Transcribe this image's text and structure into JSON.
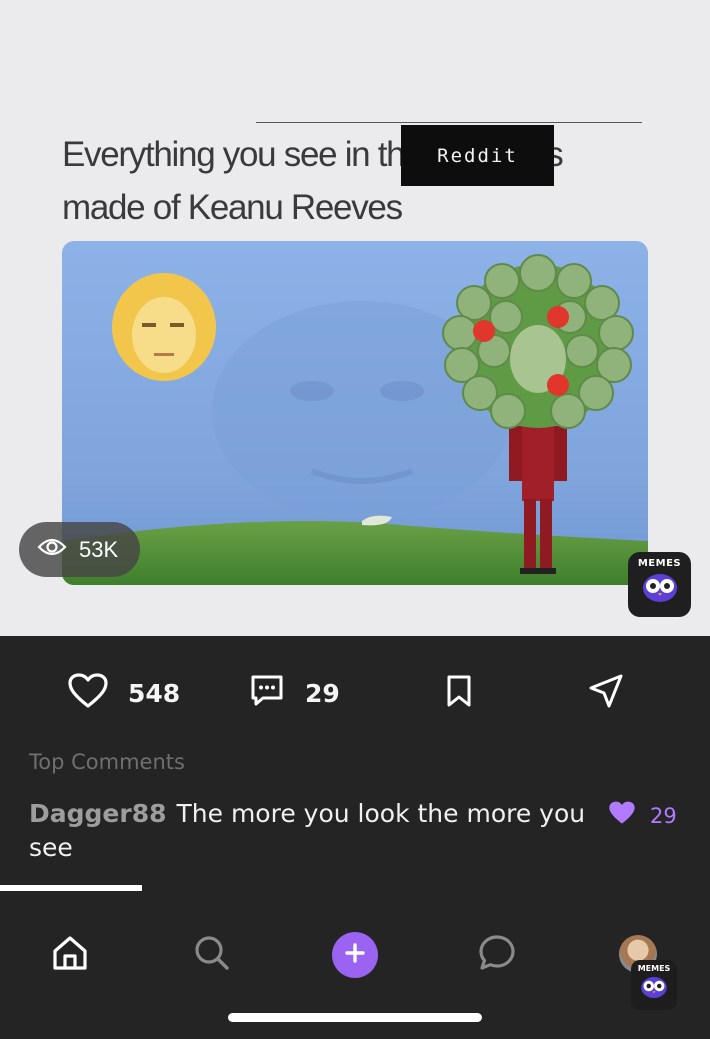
{
  "post": {
    "caption": "Everything you see in this picture is made of Keanu Reeves",
    "watermark": "Reddit",
    "views": "53K",
    "brand_badge": "MEMES"
  },
  "actions": {
    "likes": "548",
    "comments": "29"
  },
  "comments": {
    "section_title": "Top Comments",
    "items": [
      {
        "user": "Dagger88",
        "text": "The more you look the more you see",
        "likes": "29"
      }
    ]
  },
  "tabbar": {
    "badge": "MEMES"
  },
  "colors": {
    "accent": "#9b63f2",
    "like_accent": "#b07bff",
    "background": "#242424",
    "image_bg": "#ebebed"
  },
  "icons": [
    "eye-icon",
    "heart-icon",
    "comment-icon",
    "bookmark-icon",
    "share-icon",
    "home-icon",
    "search-icon",
    "plus-icon",
    "chat-icon",
    "owl-icon"
  ]
}
